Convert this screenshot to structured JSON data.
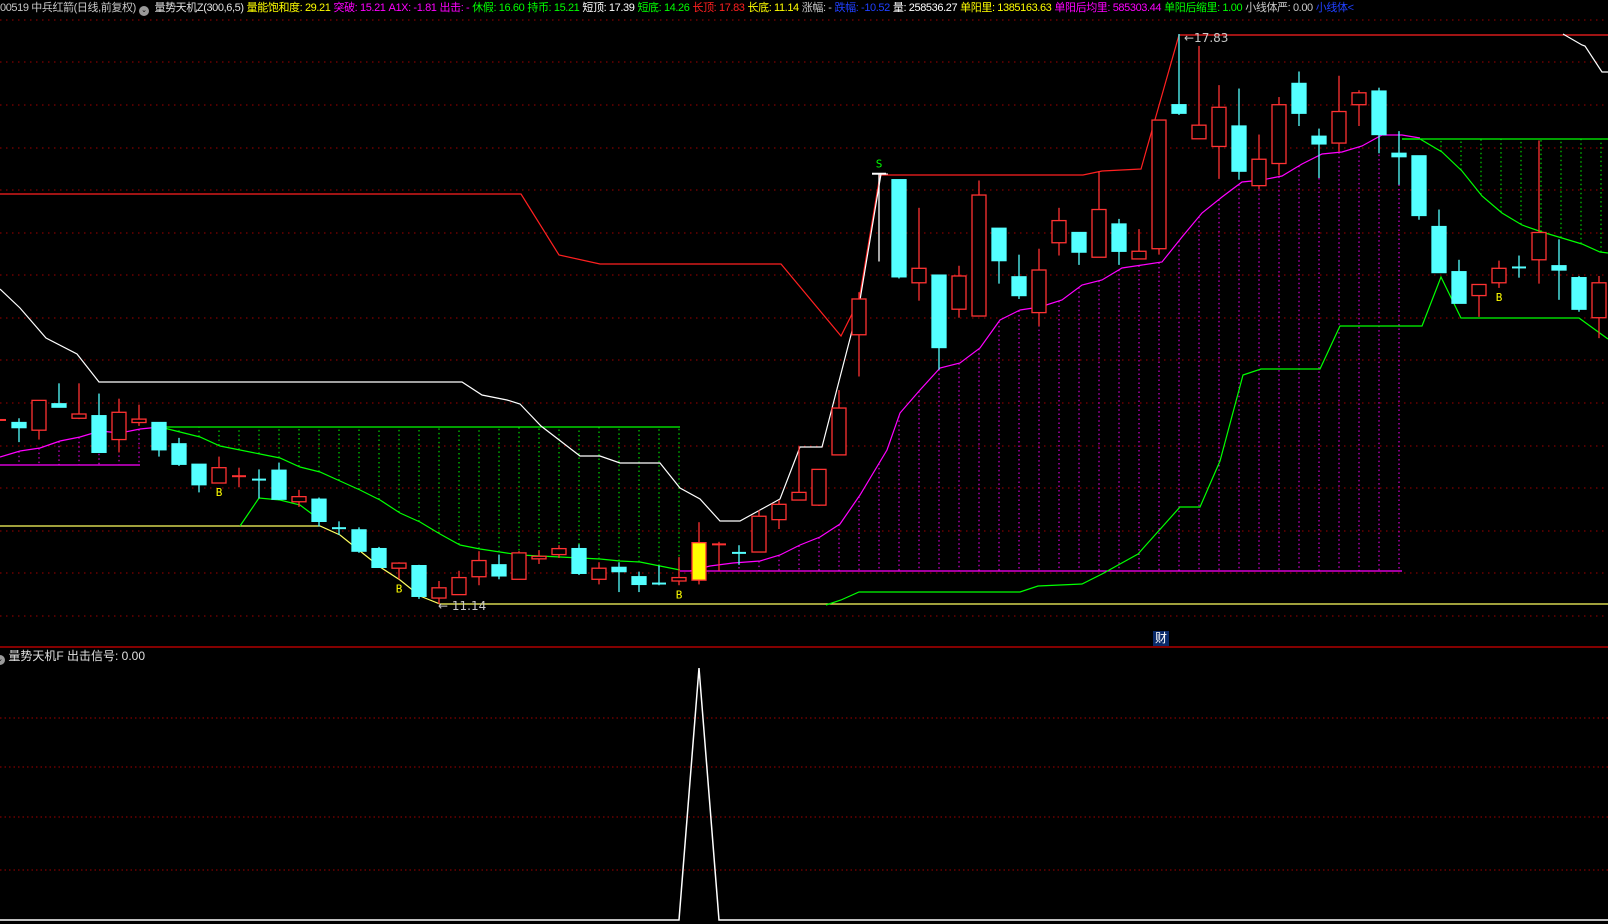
{
  "header": {
    "stock": {
      "text": "00519 中兵红箭(日线,前复权)",
      "color": "#C8C8C8"
    },
    "indicator": {
      "text": "量势天机Z(300,6,5)",
      "color": "#E0E0E0"
    },
    "items": [
      {
        "text": "量能饱和度: 29.21",
        "color": "#FFFF00"
      },
      {
        "text": "突破: 15.21",
        "color": "#FF00FF"
      },
      {
        "text": "A1X: -1.81",
        "color": "#FF00FF"
      },
      {
        "text": "出击: -",
        "color": "#FF00FF"
      },
      {
        "text": "休假: 16.60",
        "color": "#00FF00"
      },
      {
        "text": "持币: 15.21",
        "color": "#00FF00"
      },
      {
        "text": "短顶: 17.39",
        "color": "#FFFFFF"
      },
      {
        "text": "短底: 14.26",
        "color": "#00FF00"
      },
      {
        "text": "长顶: 17.83",
        "color": "#FF2020"
      },
      {
        "text": "长底: 11.14",
        "color": "#FFFF00"
      },
      {
        "text": "涨幅: -",
        "color": "#C8C8C8"
      },
      {
        "text": "跌幅: -10.52",
        "color": "#2040FF"
      },
      {
        "text": "量: 258536.27",
        "color": "#FFFFFF"
      },
      {
        "text": "单阳里: 1385163.63",
        "color": "#FFFF00"
      },
      {
        "text": "单阳后均里: 585303.44",
        "color": "#FF00FF"
      },
      {
        "text": "单阳后缩里: 1.00",
        "color": "#00FF00"
      },
      {
        "text": "小线体严: 0.00",
        "color": "#C8C8C8"
      },
      {
        "text": "小线体<",
        "color": "#2040FF"
      }
    ]
  },
  "lower_panel": {
    "title": "量势天机F 出击信号: 0.00"
  },
  "finance_badge": "财",
  "colors": {
    "up": "#FF3232",
    "down": "#54FFFF",
    "grid": "#A00000",
    "highlight": "#FFFF00"
  },
  "chart_data": [
    {
      "type": "candlestick",
      "annotations": {
        "high_label": "17.83",
        "low_label": "11.14",
        "sell_mark": "S",
        "buy_mark": "B"
      },
      "high_value": 17.83,
      "low_value": 11.14,
      "buy_marks_at_bars": [
        11,
        20,
        34,
        75
      ],
      "sell_marks_at_bars": [
        44
      ],
      "highlight_bar": 35,
      "ohlc": [
        [
          13.28,
          13.3,
          13.28,
          13.3
        ],
        [
          13.27,
          13.32,
          13.04,
          13.21
        ],
        [
          13.18,
          13.53,
          13.07,
          13.53
        ],
        [
          13.49,
          13.73,
          13.45,
          13.45
        ],
        [
          13.32,
          13.73,
          13.31,
          13.37
        ],
        [
          13.35,
          13.61,
          12.92,
          12.92
        ],
        [
          13.07,
          13.55,
          12.92,
          13.39
        ],
        [
          13.27,
          13.48,
          13.23,
          13.31
        ],
        [
          13.27,
          13.27,
          12.87,
          12.95
        ],
        [
          13.02,
          13.09,
          12.76,
          12.78
        ],
        [
          12.78,
          12.78,
          12.45,
          12.54
        ],
        [
          12.56,
          12.87,
          12.56,
          12.74
        ],
        [
          12.63,
          12.74,
          12.51,
          12.64
        ],
        [
          12.6,
          12.72,
          12.38,
          12.59
        ],
        [
          12.71,
          12.8,
          12.36,
          12.37
        ],
        [
          12.34,
          12.48,
          12.28,
          12.4
        ],
        [
          12.37,
          12.39,
          12.05,
          12.11
        ],
        [
          12.03,
          12.11,
          11.95,
          12.02
        ],
        [
          12.01,
          12.04,
          11.74,
          11.76
        ],
        [
          11.79,
          11.81,
          11.57,
          11.57
        ],
        [
          11.56,
          11.63,
          11.43,
          11.62
        ],
        [
          11.59,
          11.6,
          11.2,
          11.23
        ],
        [
          11.21,
          11.41,
          11.14,
          11.33
        ],
        [
          11.25,
          11.53,
          11.25,
          11.45
        ],
        [
          11.46,
          11.76,
          11.36,
          11.65
        ],
        [
          11.6,
          11.72,
          11.43,
          11.47
        ],
        [
          11.43,
          11.76,
          11.43,
          11.74
        ],
        [
          11.67,
          11.77,
          11.61,
          11.7
        ],
        [
          11.72,
          11.83,
          11.68,
          11.79
        ],
        [
          11.79,
          11.84,
          11.48,
          11.5
        ],
        [
          11.43,
          11.63,
          11.37,
          11.56
        ],
        [
          11.57,
          11.63,
          11.28,
          11.52
        ],
        [
          11.46,
          11.52,
          11.28,
          11.37
        ],
        [
          11.38,
          11.59,
          11.36,
          11.37
        ],
        [
          11.41,
          11.69,
          11.36,
          11.45
        ],
        [
          11.42,
          12.1,
          11.37,
          11.86
        ],
        [
          11.83,
          11.87,
          11.53,
          11.84
        ],
        [
          11.74,
          11.83,
          11.6,
          11.73
        ],
        [
          11.75,
          12.24,
          11.75,
          12.17
        ],
        [
          12.13,
          12.36,
          12.02,
          12.31
        ],
        [
          12.36,
          12.99,
          12.36,
          12.45
        ],
        [
          12.3,
          12.72,
          12.29,
          12.72
        ],
        [
          12.89,
          13.65,
          12.89,
          13.44
        ],
        [
          14.3,
          14.8,
          13.81,
          14.72
        ],
        [
          16.19,
          16.19,
          15.16,
          16.19
        ],
        [
          16.12,
          16.12,
          14.96,
          14.98
        ],
        [
          14.91,
          15.79,
          14.7,
          15.08
        ],
        [
          15.0,
          15.0,
          13.89,
          14.15
        ],
        [
          14.6,
          15.11,
          14.5,
          14.99
        ],
        [
          14.52,
          16.11,
          14.52,
          15.94
        ],
        [
          15.55,
          15.55,
          14.9,
          15.17
        ],
        [
          14.98,
          15.24,
          14.72,
          14.76
        ],
        [
          14.56,
          15.31,
          14.4,
          15.06
        ],
        [
          15.38,
          15.79,
          15.23,
          15.64
        ],
        [
          15.5,
          15.5,
          15.12,
          15.27
        ],
        [
          15.21,
          16.22,
          15.21,
          15.77
        ],
        [
          15.6,
          15.66,
          15.12,
          15.28
        ],
        [
          15.19,
          15.54,
          15.19,
          15.28
        ],
        [
          15.31,
          16.82,
          15.24,
          16.82
        ],
        [
          17.0,
          17.83,
          16.88,
          16.9
        ],
        [
          16.6,
          17.69,
          16.6,
          16.76
        ],
        [
          16.51,
          17.23,
          16.13,
          16.97
        ],
        [
          16.75,
          17.19,
          16.12,
          16.22
        ],
        [
          16.05,
          16.65,
          16.01,
          16.36
        ],
        [
          16.31,
          17.09,
          16.17,
          17.0
        ],
        [
          17.25,
          17.39,
          16.75,
          16.9
        ],
        [
          16.63,
          16.72,
          16.14,
          16.54
        ],
        [
          16.55,
          17.34,
          16.45,
          16.92
        ],
        [
          17.0,
          17.17,
          16.75,
          17.14
        ],
        [
          17.16,
          17.2,
          16.43,
          16.65
        ],
        [
          16.43,
          16.69,
          16.06,
          16.39
        ],
        [
          16.4,
          16.4,
          15.65,
          15.7
        ],
        [
          15.57,
          15.77,
          15.03,
          15.03
        ],
        [
          15.04,
          15.18,
          14.67,
          14.67
        ],
        [
          14.76,
          14.89,
          14.51,
          14.89
        ],
        [
          14.91,
          15.17,
          14.85,
          15.08
        ],
        [
          15.09,
          15.23,
          14.97,
          15.08
        ],
        [
          15.18,
          16.58,
          14.9,
          15.5
        ],
        [
          15.11,
          15.42,
          14.71,
          15.06
        ],
        [
          14.97,
          14.99,
          14.57,
          14.6
        ],
        [
          14.5,
          14.99,
          14.26,
          14.91
        ]
      ]
    },
    {
      "type": "line",
      "title": "量势天机F 出击信号",
      "ylim": [
        0,
        1
      ],
      "signal_bar": 35,
      "signal_value": 1,
      "baseline_value": 0
    }
  ]
}
